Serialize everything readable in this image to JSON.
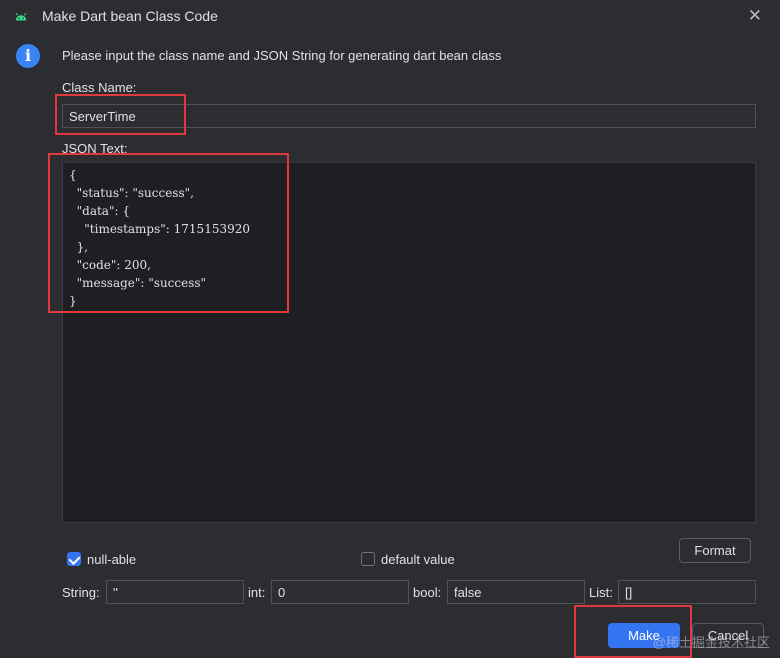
{
  "window": {
    "title": "Make Dart bean Class Code",
    "close_label": "✕"
  },
  "info": {
    "icon": "i",
    "text": "Please input the class name and JSON String for generating dart bean class"
  },
  "class_name": {
    "label": "Class Name:",
    "value": "ServerTime"
  },
  "json_text": {
    "label": "JSON Text:",
    "value": "{\n  \"status\": \"success\",\n  \"data\": {\n    \"timestamps\": 1715153920\n  },\n  \"code\": 200,\n  \"message\": \"success\"\n}"
  },
  "options": {
    "null_able": {
      "label": "null-able",
      "checked": true
    },
    "default_value": {
      "label": "default value",
      "checked": false
    },
    "format_label": "Format"
  },
  "defaults": {
    "string": {
      "label": "String:",
      "value": "''"
    },
    "int": {
      "label": "int:",
      "value": "0"
    },
    "bool": {
      "label": "bool:",
      "value": "false"
    },
    "list": {
      "label": "List:",
      "value": "[]"
    }
  },
  "actions": {
    "make_label": "Make",
    "cancel_label": "Cancel"
  },
  "watermark": "@稀土掘金技术社区",
  "colors": {
    "accent": "#3574f0",
    "highlight": "#e0383e",
    "info": "#3b82f6",
    "android_green": "#3ddc84"
  }
}
